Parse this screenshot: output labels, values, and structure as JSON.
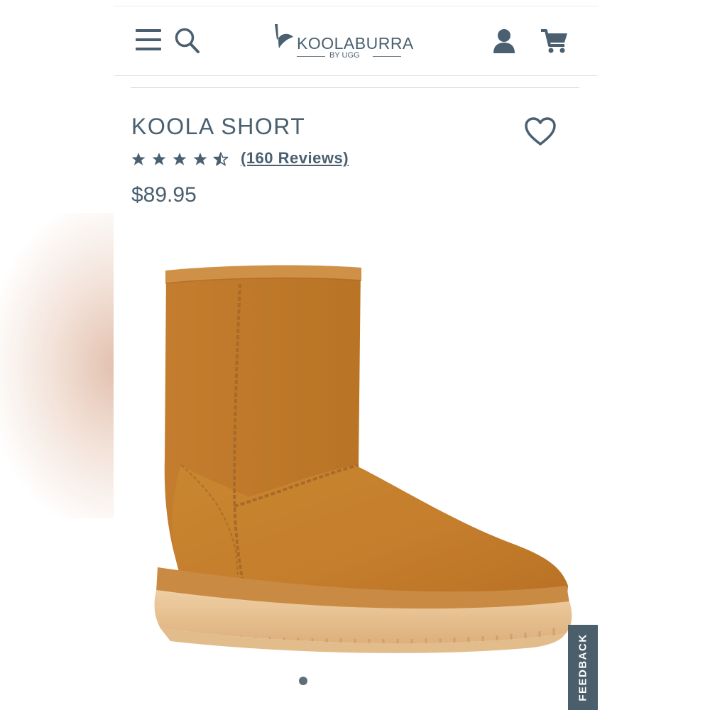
{
  "header": {
    "brand": "KOOLABURRA",
    "brand_sub": "BY UGG",
    "icons": [
      "menu-icon",
      "search-icon",
      "account-icon",
      "cart-icon"
    ]
  },
  "product": {
    "title": "KOOLA SHORT",
    "rating": 4.5,
    "rating_max": 5,
    "reviews_label": "(160 Reviews)",
    "price": "$89.95",
    "favorite_icon": "heart-icon"
  },
  "gallery": {
    "image_count": 1,
    "active_index": 0
  },
  "feedback": {
    "label": "FEEDBACK"
  },
  "colors": {
    "text": "#4a6070",
    "boot": "#c7802f",
    "sole": "#e6bd8d",
    "feedback_bg": "#4b5e6b"
  }
}
